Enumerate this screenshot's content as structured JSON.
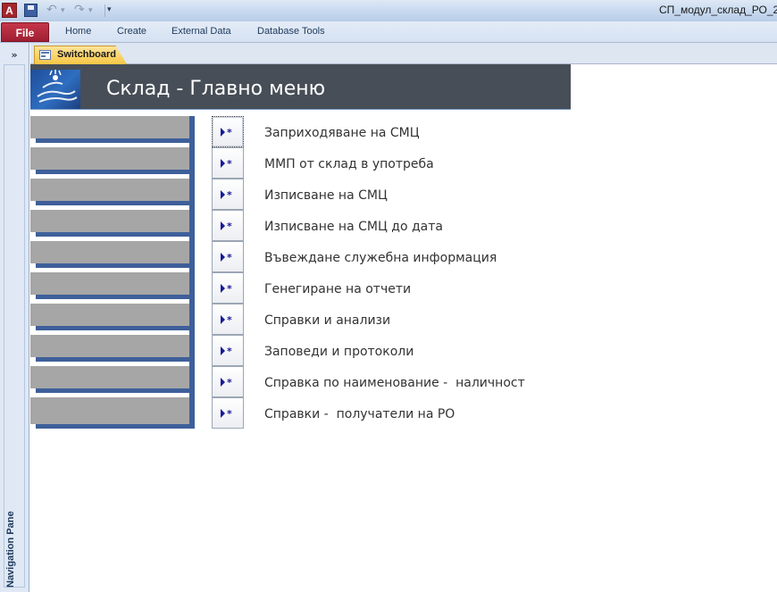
{
  "titlebar": {
    "app_icon_label": "A",
    "window_title": "СП_модул_склад_РО_2"
  },
  "ribbon": {
    "file_tab": "File",
    "tabs": [
      "Home",
      "Create",
      "External Data",
      "Database Tools"
    ]
  },
  "navigation_pane": {
    "collapse_label": "»",
    "label": "Navigation Pane"
  },
  "document_tab": {
    "label": "Switchboard"
  },
  "form": {
    "title": "Склад - Главно меню",
    "items": [
      {
        "label": "Заприходяване на СМЦ"
      },
      {
        "label": "ММП от склад в употреба"
      },
      {
        "label": "Изписване на СМЦ"
      },
      {
        "label": "Изписване на СМЦ до дата"
      },
      {
        "label": "Въвеждане служебна информация"
      },
      {
        "label": "Генегиране на отчети"
      },
      {
        "label": "Справки и анализи"
      },
      {
        "label": "Заповеди и протоколи"
      },
      {
        "label": "Справка по наименование -  наличност"
      },
      {
        "label": "Справки -  получатели на РО"
      }
    ]
  },
  "colors": {
    "header_band": "#474e57",
    "accent_blue": "#3e5f9a",
    "grey_panel": "#a6a6a6",
    "file_tab": "#b02b3e",
    "doc_tab": "#f9d36a",
    "button_glyph": "#1a1a9a"
  },
  "icons": {
    "app": "access-app-icon",
    "save": "save-icon",
    "undo": "undo-icon",
    "redo": "redo-icon",
    "customize": "customize-qat-icon",
    "document_tab": "form-icon",
    "menu_button": "run-command-icon",
    "logo": "company-logo-icon"
  }
}
